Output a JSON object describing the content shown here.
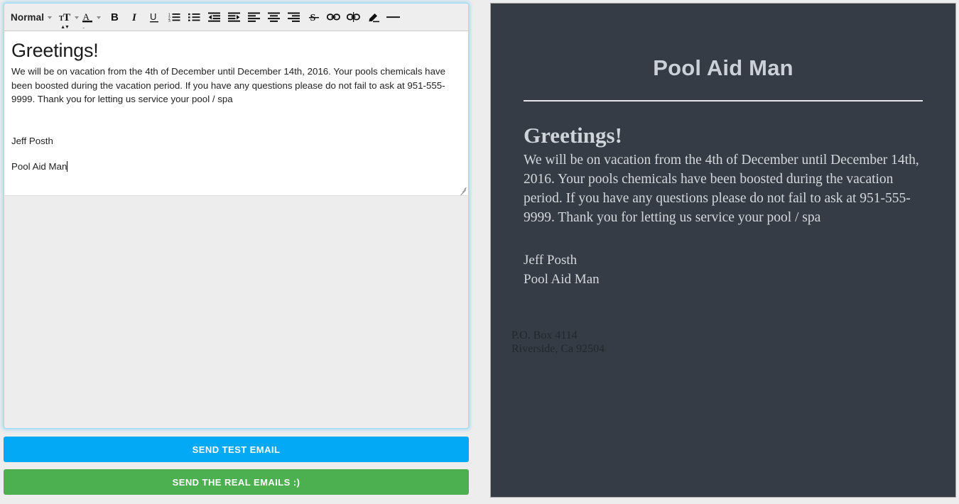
{
  "editor": {
    "toolbar": {
      "format_label": "Normal",
      "buttons": [
        {
          "name": "font-size-icon",
          "title": "Font size"
        },
        {
          "name": "font-color-icon",
          "title": "Font color"
        },
        {
          "name": "bold-icon",
          "title": "Bold"
        },
        {
          "name": "italic-icon",
          "title": "Italic"
        },
        {
          "name": "underline-icon",
          "title": "Underline"
        },
        {
          "name": "ordered-list-icon",
          "title": "Numbered list"
        },
        {
          "name": "bullet-list-icon",
          "title": "Bulleted list"
        },
        {
          "name": "outdent-icon",
          "title": "Decrease indent"
        },
        {
          "name": "indent-icon",
          "title": "Increase indent"
        },
        {
          "name": "align-left-icon",
          "title": "Align left"
        },
        {
          "name": "align-center-icon",
          "title": "Align center"
        },
        {
          "name": "align-right-icon",
          "title": "Align right"
        },
        {
          "name": "strikethrough-icon",
          "title": "Strikethrough"
        },
        {
          "name": "link-icon",
          "title": "Insert link"
        },
        {
          "name": "unlink-icon",
          "title": "Remove link"
        },
        {
          "name": "clear-format-icon",
          "title": "Clear formatting"
        },
        {
          "name": "horizontal-rule-icon",
          "title": "Horizontal rule"
        }
      ]
    },
    "content": {
      "heading": "Greetings!",
      "paragraph": "We will be on vacation from the 4th of December until December 14th, 2016. Your pools chemicals have been boosted during the vacation period. If you have any questions please do not fail to ask at 951-555-9999. Thank you for letting us service your pool / spa",
      "signature_name": "Jeff Posth",
      "signature_company": "Pool Aid Man"
    }
  },
  "actions": {
    "send_test_label": "SEND TEST EMAIL",
    "send_real_label": "SEND THE REAL EMAILS :)"
  },
  "preview": {
    "title": "Pool Aid Man",
    "heading": "Greetings!",
    "paragraph": "We will be on vacation from the 4th of December until December 14th, 2016. Your pools chemicals have been boosted during the vacation period. If you have any questions please do not fail to ask at 951-555-9999. Thank you for letting us service your pool / spa",
    "signature_name": "Jeff Posth",
    "signature_company": "Pool Aid Man",
    "footer_line1": "P.O. Box 4114",
    "footer_line2": "Riverside, Ca 92504"
  },
  "colors": {
    "page_background": "#ededed",
    "editor_focus_glow": "#74cef0",
    "toolbar_background": "#eeeeee",
    "test_button": "#03a9f4",
    "real_button": "#4caf50",
    "preview_background": "#363c45",
    "preview_text": "#d4d8dd",
    "preview_footer_text": "#23272e"
  }
}
